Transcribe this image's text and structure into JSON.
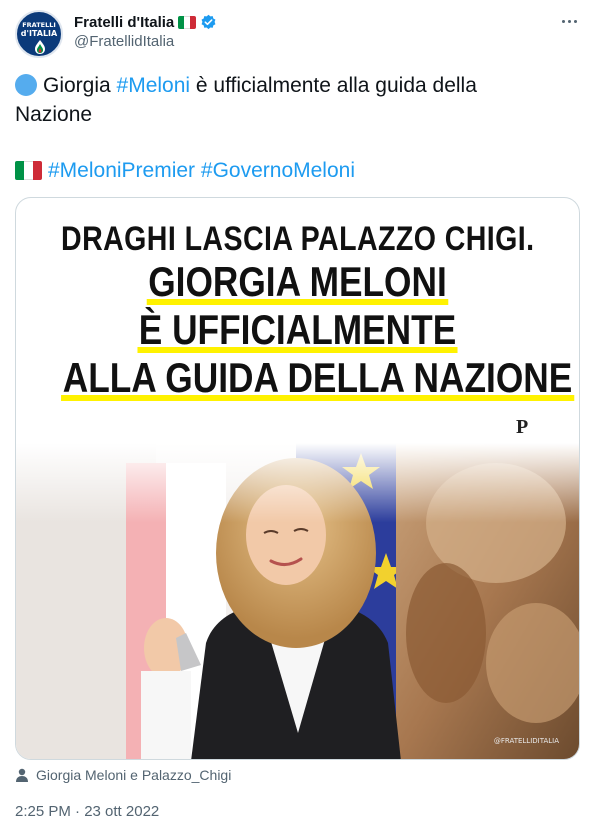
{
  "author": {
    "display_name": "Fratelli d'Italia",
    "handle": "@FratellidItalia",
    "avatar_line1": "FRATELLI",
    "avatar_line2": "d'ITALIA",
    "flag_colors": [
      "#009246",
      "#ffffff",
      "#ce2b37"
    ],
    "verified_color": "#1d9bf0"
  },
  "tweet": {
    "line1_prefix": "Giorgia ",
    "line1_link": "#Meloni",
    "line1_suffix": " è ufficialmente alla guida della",
    "line2": "Nazione",
    "hashtag1": "#MeloniPremier",
    "hashtag2": "#GovernoMeloni",
    "link_color": "#1d9bf0"
  },
  "media": {
    "headline1": "DRAGHI LASCIA PALAZZO CHIGI.",
    "headline2": "GIORGIA MELONI",
    "headline3": "È UFFICIALMENTE",
    "headline4": "ALLA GUIDA DELLA NAZIONE",
    "logo": "P",
    "watermark": "@FRATELLIDITALIA",
    "highlight_color": "#fff200"
  },
  "caption": "Giorgia Meloni e Palazzo_Chigi",
  "timestamp": "2:25 PM · 23 ott 2022"
}
